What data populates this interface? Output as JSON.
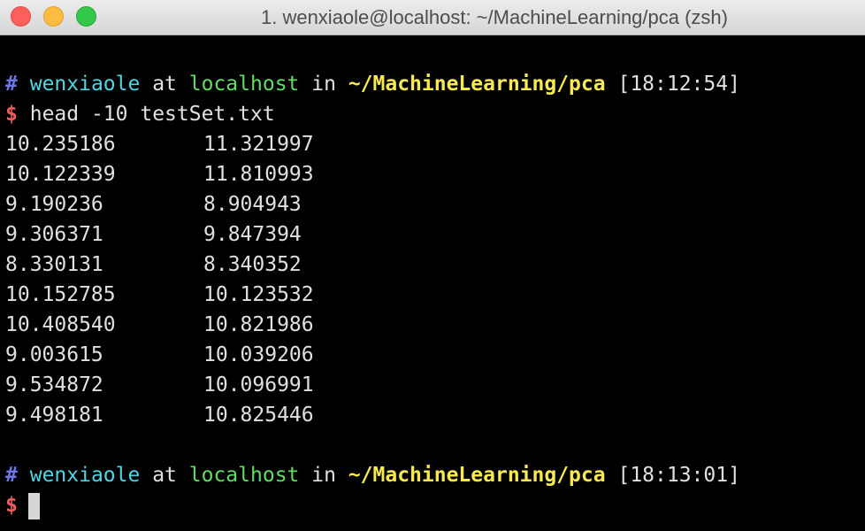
{
  "window": {
    "title": "1. wenxiaole@localhost: ~/MachineLearning/pca (zsh)"
  },
  "prompt1": {
    "hash": "#",
    "user": "wenxiaole",
    "at": "at",
    "host": "localhost",
    "in": "in",
    "path": "~/MachineLearning/pca",
    "time": "[18:12:54]",
    "dollar": "$",
    "command": "head -10 testSet.txt"
  },
  "output": [
    [
      "10.235186",
      "11.321997"
    ],
    [
      "10.122339",
      "11.810993"
    ],
    [
      "9.190236",
      "8.904943"
    ],
    [
      "9.306371",
      "9.847394"
    ],
    [
      "8.330131",
      "8.340352"
    ],
    [
      "10.152785",
      "10.123532"
    ],
    [
      "10.408540",
      "10.821986"
    ],
    [
      "9.003615",
      "10.039206"
    ],
    [
      "9.534872",
      "10.096991"
    ],
    [
      "9.498181",
      "10.825446"
    ]
  ],
  "prompt2": {
    "hash": "#",
    "user": "wenxiaole",
    "at": "at",
    "host": "localhost",
    "in": "in",
    "path": "~/MachineLearning/pca",
    "time": "[18:13:01]",
    "dollar": "$"
  },
  "colors": {
    "hash": "#6a78e8",
    "user": "#4fd6e3",
    "host": "#5fdf5f",
    "path": "#f7e94e",
    "dollar": "#f05b5b",
    "text": "#e0e0e0",
    "background": "#000000"
  }
}
